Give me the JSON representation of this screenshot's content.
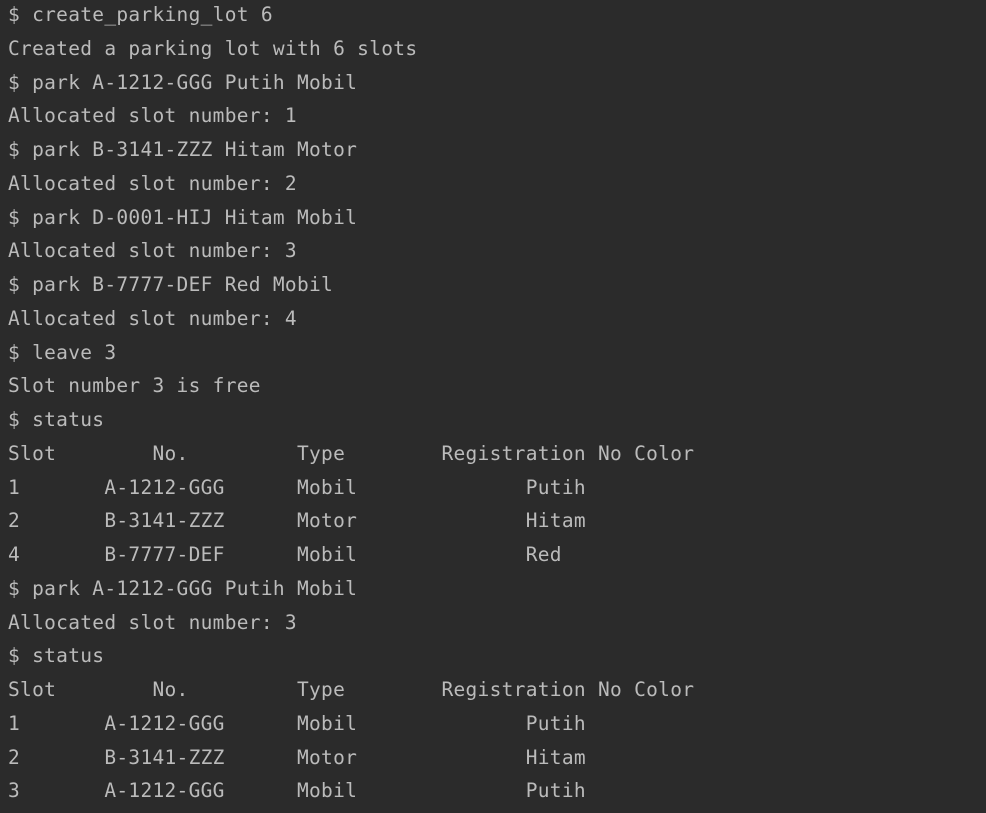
{
  "terminal": {
    "lines": [
      "$ create_parking_lot 6",
      "Created a parking lot with 6 slots",
      "$ park A-1212-GGG Putih Mobil",
      "Allocated slot number: 1",
      "$ park B-3141-ZZZ Hitam Motor",
      "Allocated slot number: 2",
      "$ park D-0001-HIJ Hitam Mobil",
      "Allocated slot number: 3",
      "$ park B-7777-DEF Red Mobil",
      "Allocated slot number: 4",
      "$ leave 3",
      "Slot number 3 is free",
      "$ status",
      "Slot        No.         Type        Registration No Color",
      "1       A-1212-GGG      Mobil              Putih",
      "2       B-3141-ZZZ      Motor              Hitam",
      "4       B-7777-DEF      Mobil              Red",
      "$ park A-1212-GGG Putih Mobil",
      "Allocated slot number: 3",
      "$ status",
      "Slot        No.         Type        Registration No Color",
      "1       A-1212-GGG      Mobil              Putih",
      "2       B-3141-ZZZ      Motor              Hitam",
      "3       A-1212-GGG      Mobil              Putih"
    ]
  }
}
